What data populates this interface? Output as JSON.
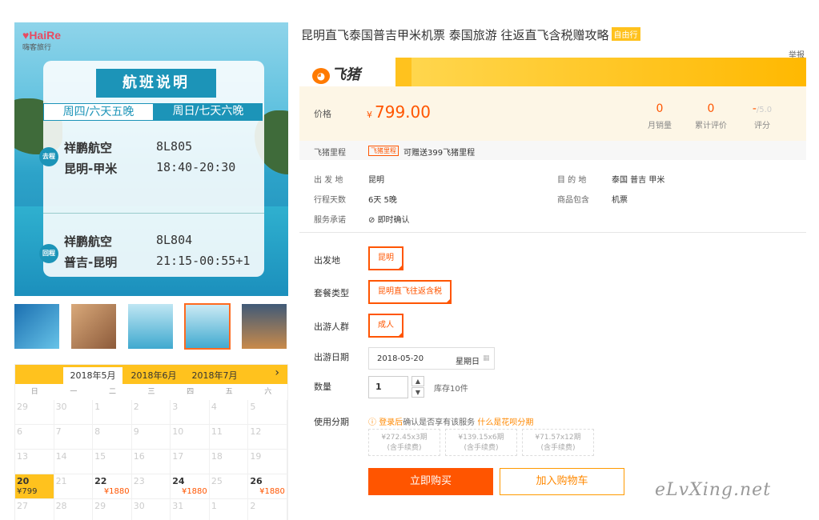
{
  "gallery": {
    "logo_brand": "HaiRe",
    "logo_sub": "嗨客旅行",
    "card_title": "航班说明",
    "tab_a": "周四/六天五晚",
    "tab_b": "周日/七天六晚",
    "outbound": {
      "badge": "去程",
      "airline": "祥鹏航空",
      "flight": "8L805",
      "route": "昆明-甲米",
      "time": "18:40-20:30"
    },
    "return": {
      "badge": "回程",
      "airline": "祥鹏航空",
      "flight": "8L804",
      "route": "普吉-昆明",
      "time": "21:15-00:55+1"
    }
  },
  "calendar": {
    "months": [
      "2018年5月",
      "2018年6月",
      "2018年7月"
    ],
    "next": "›",
    "weekdays": [
      "日",
      "一",
      "二",
      "三",
      "四",
      "五",
      "六"
    ],
    "rows": [
      [
        {
          "d": "29"
        },
        {
          "d": "30"
        },
        {
          "d": "1"
        },
        {
          "d": "2"
        },
        {
          "d": "3"
        },
        {
          "d": "4"
        },
        {
          "d": "5"
        }
      ],
      [
        {
          "d": "6"
        },
        {
          "d": "7"
        },
        {
          "d": "8"
        },
        {
          "d": "9"
        },
        {
          "d": "10"
        },
        {
          "d": "11"
        },
        {
          "d": "12"
        }
      ],
      [
        {
          "d": "13"
        },
        {
          "d": "14"
        },
        {
          "d": "15"
        },
        {
          "d": "16"
        },
        {
          "d": "17"
        },
        {
          "d": "18"
        },
        {
          "d": "19"
        }
      ],
      [
        {
          "d": "20",
          "p": "¥799",
          "sel": true
        },
        {
          "d": "21"
        },
        {
          "d": "22",
          "p": "¥1880"
        },
        {
          "d": "23"
        },
        {
          "d": "24",
          "p": "¥1880"
        },
        {
          "d": "25"
        },
        {
          "d": "26",
          "p": "¥1880"
        }
      ],
      [
        {
          "d": "27"
        },
        {
          "d": "28"
        },
        {
          "d": "29"
        },
        {
          "d": "30"
        },
        {
          "d": "31"
        },
        {
          "d": "1"
        },
        {
          "d": "2"
        }
      ]
    ]
  },
  "product": {
    "title": "昆明直飞泰国普吉甲米机票 泰国旅游 往返直飞含税赠攻略",
    "tag": "自由行",
    "report": "举报",
    "brand": "飞猪",
    "price_label": "价格",
    "currency": "¥",
    "price": "799.00",
    "stats": [
      {
        "value": "0",
        "label": "月销量"
      },
      {
        "value": "0",
        "label": "累计评价"
      },
      {
        "value": "-",
        "suffix": "/5.0",
        "label": "评分"
      }
    ],
    "miles_label": "飞猪里程",
    "miles_pill": "飞猪里程",
    "miles_text": "可赠送399飞猪里程",
    "info": {
      "from_k": "出 发 地",
      "from_v": "昆明",
      "to_k": "目 的 地",
      "to_v": "泰国  普吉  甲米",
      "days_k": "行程天数",
      "days_v": "6天  5晚",
      "incl_k": "商品包含",
      "incl_v": "机票",
      "promise_k": "服务承诺",
      "promise_v": "即时确认"
    },
    "options": {
      "dep_label": "出发地",
      "dep_value": "昆明",
      "pkg_label": "套餐类型",
      "pkg_value": "昆明直飞往返含税",
      "crowd_label": "出游人群",
      "crowd_value": "成人",
      "date_label": "出游日期",
      "date_value": "2018-05-20",
      "weekday": "星期日",
      "qty_label": "数量",
      "qty_value": "1",
      "stock": "库存10件",
      "inst_label": "使用分期"
    },
    "installment_note": {
      "login": "登录后",
      "mid": "确认是否享有该服务",
      "link": "什么是花呗分期"
    },
    "installments": [
      {
        "line1": "¥272.45x3期",
        "line2": "(含手续费)"
      },
      {
        "line1": "¥139.15x6期",
        "line2": "(含手续费)"
      },
      {
        "line1": "¥71.57x12期",
        "line2": "(含手续费)"
      }
    ],
    "buy": "立即购买",
    "cart": "加入购物车",
    "watermark": "eLvXing.net"
  },
  "colors": {
    "accent": "#ff5500",
    "brand_yellow": "#ffc21e",
    "teal": "#1c94b8"
  }
}
